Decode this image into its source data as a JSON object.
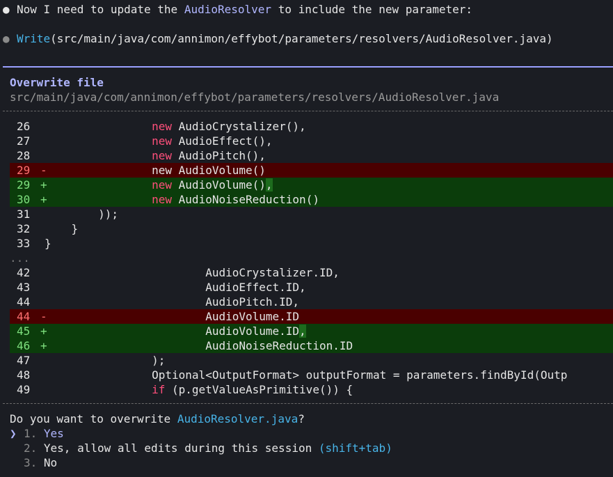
{
  "messages": {
    "intro_prefix": "Now I need to update the ",
    "intro_class": "AudioResolver",
    "intro_suffix": " to include the new parameter:",
    "tool_name": "Write",
    "tool_arg": "(src/main/java/com/annimon/effybot/parameters/resolvers/AudioResolver.java)",
    "bullet": "●"
  },
  "dialog": {
    "title": "Overwrite file",
    "path": "src/main/java/com/annimon/effybot/parameters/resolvers/AudioResolver.java",
    "ellipsis": "...",
    "question_prefix": "Do you want to overwrite ",
    "question_file": "AudioResolver.java",
    "question_suffix": "?",
    "options": [
      {
        "pointer": "❯",
        "number": "1.",
        "label": "Yes",
        "shortcut": ""
      },
      {
        "pointer": "",
        "number": "2.",
        "label": "Yes, allow all edits during this session ",
        "shortcut": "(shift+tab)"
      },
      {
        "pointer": "",
        "number": "3.",
        "label": "No",
        "shortcut": ""
      }
    ]
  },
  "diff": {
    "hunk1": [
      {
        "ln": "26",
        "mark": "",
        "type": "ctx",
        "indent": "                ",
        "kw": "new",
        "rest": " AudioCrystalizer(),",
        "hl": ""
      },
      {
        "ln": "27",
        "mark": "",
        "type": "ctx",
        "indent": "                ",
        "kw": "new",
        "rest": " AudioEffect(),",
        "hl": ""
      },
      {
        "ln": "28",
        "mark": "",
        "type": "ctx",
        "indent": "                ",
        "kw": "new",
        "rest": " AudioPitch(),",
        "hl": ""
      },
      {
        "ln": "29",
        "mark": "-",
        "type": "removed",
        "indent": "                ",
        "kw": "",
        "rest": "new AudioVolume()",
        "hl": ""
      },
      {
        "ln": "29",
        "mark": "+",
        "type": "added",
        "indent": "                ",
        "kw": "new",
        "rest": " AudioVolume()",
        "hl": ","
      },
      {
        "ln": "30",
        "mark": "+",
        "type": "added",
        "indent": "                ",
        "kw": "new",
        "rest": " AudioNoiseReduction()",
        "hl": ""
      },
      {
        "ln": "31",
        "mark": "",
        "type": "ctx",
        "indent": "        ",
        "kw": "",
        "rest": "));",
        "hl": ""
      },
      {
        "ln": "32",
        "mark": "",
        "type": "ctx",
        "indent": "    ",
        "kw": "",
        "rest": "}",
        "hl": ""
      },
      {
        "ln": "33",
        "mark": "",
        "type": "ctx",
        "indent": "",
        "kw": "",
        "rest": "}",
        "hl": ""
      }
    ],
    "hunk2": [
      {
        "ln": "42",
        "mark": "",
        "type": "ctx",
        "indent": "                        ",
        "kw": "",
        "rest": "AudioCrystalizer.ID,",
        "hl": ""
      },
      {
        "ln": "43",
        "mark": "",
        "type": "ctx",
        "indent": "                        ",
        "kw": "",
        "rest": "AudioEffect.ID,",
        "hl": ""
      },
      {
        "ln": "44",
        "mark": "",
        "type": "ctx",
        "indent": "                        ",
        "kw": "",
        "rest": "AudioPitch.ID,",
        "hl": ""
      },
      {
        "ln": "44",
        "mark": "-",
        "type": "removed",
        "indent": "                        ",
        "kw": "",
        "rest": "AudioVolume.ID",
        "hl": ""
      },
      {
        "ln": "45",
        "mark": "+",
        "type": "added",
        "indent": "                        ",
        "kw": "",
        "rest": "AudioVolume.ID",
        "hl": ","
      },
      {
        "ln": "46",
        "mark": "+",
        "type": "added",
        "indent": "                        ",
        "kw": "",
        "rest": "AudioNoiseReduction.ID",
        "hl": ""
      },
      {
        "ln": "47",
        "mark": "",
        "type": "ctx",
        "indent": "                ",
        "kw": "",
        "rest": ");",
        "hl": ""
      },
      {
        "ln": "48",
        "mark": "",
        "type": "ctx",
        "indent": "                ",
        "kw": "",
        "rest": "Optional<OutputFormat> outputFormat = parameters.findById(Outp",
        "hl": ""
      },
      {
        "ln": "49",
        "mark": "",
        "type": "ctx",
        "indent": "                ",
        "kw": "if",
        "rest": " (p.getValueAsPrimitive()) {",
        "hl": ""
      }
    ]
  },
  "colors": {
    "background": "#1b1d23",
    "accent": "#b0b6ff",
    "link": "#48b4e8",
    "keyword": "#ff4f7b",
    "removed_bg": "#4a0000",
    "added_bg": "#0b3d0b"
  }
}
